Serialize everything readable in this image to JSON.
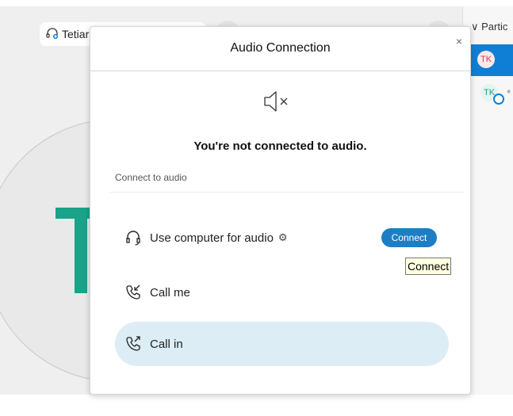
{
  "background": {
    "presenter_name": "Tetiar",
    "presenter_initial": "T"
  },
  "sidebar": {
    "header": "Partic",
    "participants": [
      {
        "initials": "TK"
      },
      {
        "initials": "TK"
      }
    ]
  },
  "dialog": {
    "title": "Audio Connection",
    "close_glyph": "×",
    "status": "You're not connected to audio.",
    "section_label": "Connect to audio",
    "options": [
      {
        "label": "Use computer for audio",
        "icon": "headset-icon"
      },
      {
        "label": "Call me",
        "icon": "phone-incoming-icon"
      },
      {
        "label": "Call in",
        "icon": "phone-outgoing-icon"
      }
    ],
    "connect_button": "Connect",
    "tooltip": "Connect",
    "gear_glyph": "⚙"
  },
  "colors": {
    "accent": "#1c7ec5",
    "teal": "#1aa389",
    "selected_option": "#dcedf6"
  }
}
